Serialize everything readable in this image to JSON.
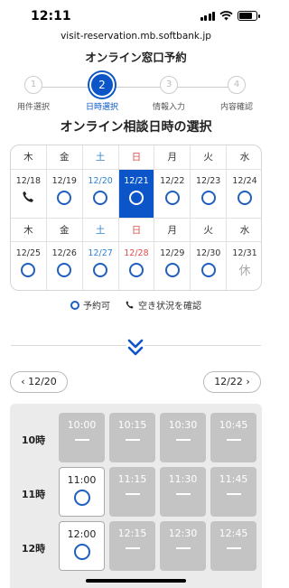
{
  "status_bar": {
    "time": "12:11"
  },
  "browser": {
    "url": "visit-reservation.mb.softbank.jp"
  },
  "page": {
    "title": "オンライン窓口予約",
    "section_title": "オンライン相談日時の選択"
  },
  "stepper": {
    "steps": [
      {
        "number": "1",
        "label": "用件選択"
      },
      {
        "number": "2",
        "label": "日時選択"
      },
      {
        "number": "3",
        "label": "情報入力"
      },
      {
        "number": "4",
        "label": "内容確認"
      }
    ],
    "current_step": 2
  },
  "calendar": {
    "weeks": [
      {
        "weekdays": [
          "木",
          "金",
          "土",
          "日",
          "月",
          "火",
          "水"
        ],
        "days": [
          {
            "date": "12/18",
            "status": "phone"
          },
          {
            "date": "12/19",
            "status": "available"
          },
          {
            "date": "12/20",
            "status": "available"
          },
          {
            "date": "12/21",
            "status": "available",
            "selected": true
          },
          {
            "date": "12/22",
            "status": "available"
          },
          {
            "date": "12/23",
            "status": "available"
          },
          {
            "date": "12/24",
            "status": "available"
          }
        ]
      },
      {
        "weekdays": [
          "木",
          "金",
          "土",
          "日",
          "月",
          "火",
          "水"
        ],
        "days": [
          {
            "date": "12/25",
            "status": "available"
          },
          {
            "date": "12/26",
            "status": "available"
          },
          {
            "date": "12/27",
            "status": "available"
          },
          {
            "date": "12/28",
            "status": "available"
          },
          {
            "date": "12/29",
            "status": "available"
          },
          {
            "date": "12/30",
            "status": "available"
          },
          {
            "date": "12/31",
            "status": "closed",
            "closed_label": "休"
          }
        ]
      }
    ]
  },
  "legend": {
    "available": "予約可",
    "phone": "空き状況を確認"
  },
  "day_nav": {
    "prev": "12/20",
    "next": "12/22"
  },
  "timeslots": {
    "rows": [
      {
        "hour": "10時",
        "slots": [
          {
            "time": "10:00",
            "available": false
          },
          {
            "time": "10:15",
            "available": false
          },
          {
            "time": "10:30",
            "available": false
          },
          {
            "time": "10:45",
            "available": false
          }
        ]
      },
      {
        "hour": "11時",
        "slots": [
          {
            "time": "11:00",
            "available": true
          },
          {
            "time": "11:15",
            "available": false
          },
          {
            "time": "11:30",
            "available": false
          },
          {
            "time": "11:45",
            "available": false
          }
        ]
      },
      {
        "hour": "12時",
        "slots": [
          {
            "time": "12:00",
            "available": true
          },
          {
            "time": "12:15",
            "available": false
          },
          {
            "time": "12:30",
            "available": false
          },
          {
            "time": "12:45",
            "available": false
          }
        ]
      }
    ]
  },
  "colors": {
    "accent": "#0b55c8",
    "saturday": "#2c82d0",
    "sunday": "#e14d4d",
    "unavailable": "#c4c4c4"
  }
}
